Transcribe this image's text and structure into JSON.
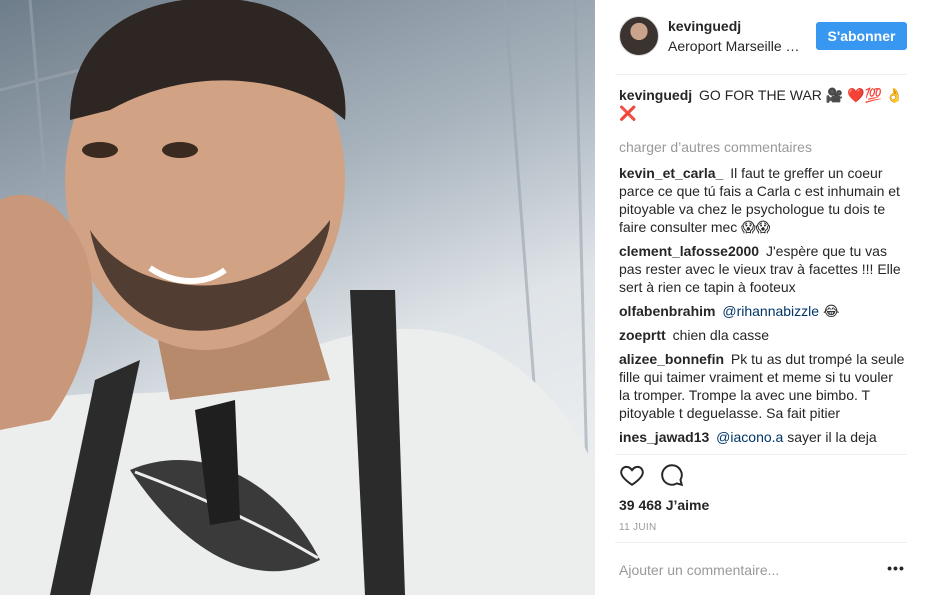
{
  "post": {
    "author": "kevinguedj",
    "location": "Aeroport Marseille Provence",
    "follow_label": "S'abonner",
    "caption_author": "kevinguedj",
    "caption_text": "GO FOR THE WAR 🎥 ❤️💯 👌❌",
    "load_more": "charger d’autres commentaires",
    "likes": "39 468 J’aime",
    "date": "11 JUIN",
    "add_comment_placeholder": "Ajouter un commentaire...",
    "more_label": "•••"
  },
  "comments": [
    {
      "author": "kevin_et_carla_",
      "mention": "",
      "text": "Il faut te greffer un coeur parce ce que tú fais a Carla c est inhumain et pitoyable va chez le psychologue tu dois te faire consulter mec 😱😱"
    },
    {
      "author": "clement_lafosse2000",
      "mention": "",
      "text": "J'espère que tu vas pas rester avec le vieux trav à facettes !!! Elle sert à rien ce tapin à footeux"
    },
    {
      "author": "olfabenbrahim",
      "mention": "@rihannabizzle",
      "text": "😂"
    },
    {
      "author": "zoeprtt",
      "mention": "",
      "text": "chien dla casse"
    },
    {
      "author": "alizee_bonnefin",
      "mention": "",
      "text": "Pk tu as dut trompé la seule fille qui taimer vraiment et meme si tu vouler la tromper. Trompe la avec une bimbo. T pitoyable t deguelasse. Sa fait pitier"
    },
    {
      "author": "ines_jawad13",
      "mention": "@iacono.a",
      "text": "sayer il la deja"
    }
  ],
  "icons": {
    "like": "heart-icon",
    "comment": "comment-icon",
    "more": "more-options-icon"
  },
  "colors": {
    "accent": "#3897f0",
    "text": "#262626",
    "muted": "#999999",
    "mention": "#003569"
  }
}
